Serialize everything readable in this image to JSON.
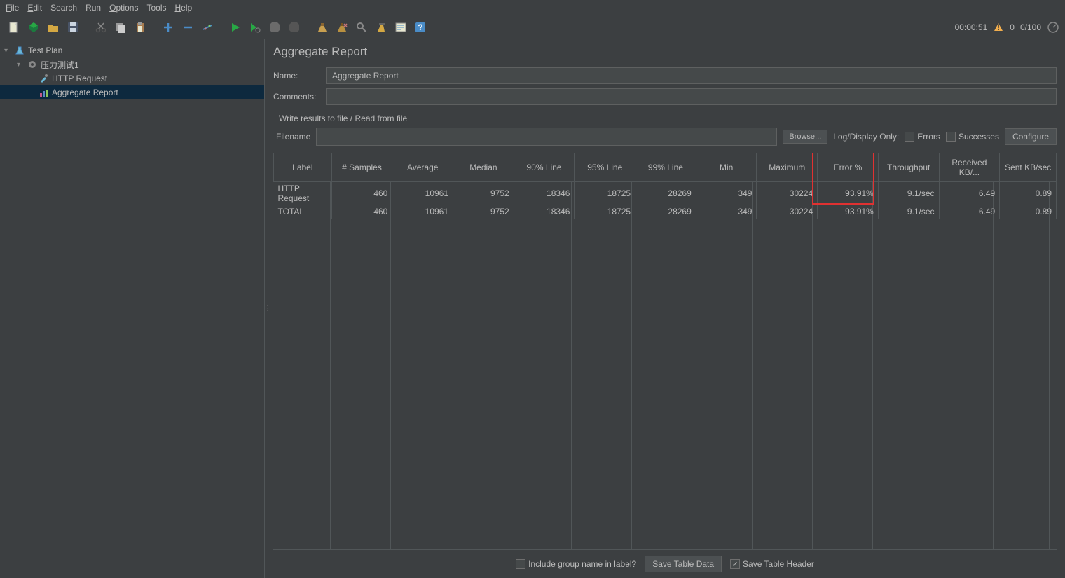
{
  "menu": {
    "file": "File",
    "edit": "Edit",
    "search": "Search",
    "run": "Run",
    "options": "Options",
    "tools": "Tools",
    "help": "Help"
  },
  "status": {
    "time": "00:00:51",
    "warn_count": "0",
    "threads": "0/100"
  },
  "tree": {
    "test_plan": "Test Plan",
    "thread_group": "压力测试1",
    "http_request": "HTTP Request",
    "aggregate_report": "Aggregate Report"
  },
  "panel": {
    "title": "Aggregate Report",
    "name_label": "Name:",
    "name_value": "Aggregate Report",
    "comments_label": "Comments:",
    "write_section": "Write results to file / Read from file",
    "filename_label": "Filename",
    "browse": "Browse...",
    "log_display": "Log/Display Only:",
    "errors": "Errors",
    "successes": "Successes",
    "configure": "Configure"
  },
  "table": {
    "headers": [
      "Label",
      "# Samples",
      "Average",
      "Median",
      "90% Line",
      "95% Line",
      "99% Line",
      "Min",
      "Maximum",
      "Error %",
      "Throughput",
      "Received KB/...",
      "Sent KB/sec"
    ],
    "rows": [
      {
        "label": "HTTP Request",
        "samples": "460",
        "average": "10961",
        "median": "9752",
        "p90": "18346",
        "p95": "18725",
        "p99": "28269",
        "min": "349",
        "max": "30224",
        "error": "93.91%",
        "throughput": "9.1/sec",
        "received": "6.49",
        "sent": "0.89"
      },
      {
        "label": "TOTAL",
        "samples": "460",
        "average": "10961",
        "median": "9752",
        "p90": "18346",
        "p95": "18725",
        "p99": "28269",
        "min": "349",
        "max": "30224",
        "error": "93.91%",
        "throughput": "9.1/sec",
        "received": "6.49",
        "sent": "0.89"
      }
    ]
  },
  "footer": {
    "include_group": "Include group name in label?",
    "save_table_data": "Save Table Data",
    "save_table_header": "Save Table Header"
  }
}
